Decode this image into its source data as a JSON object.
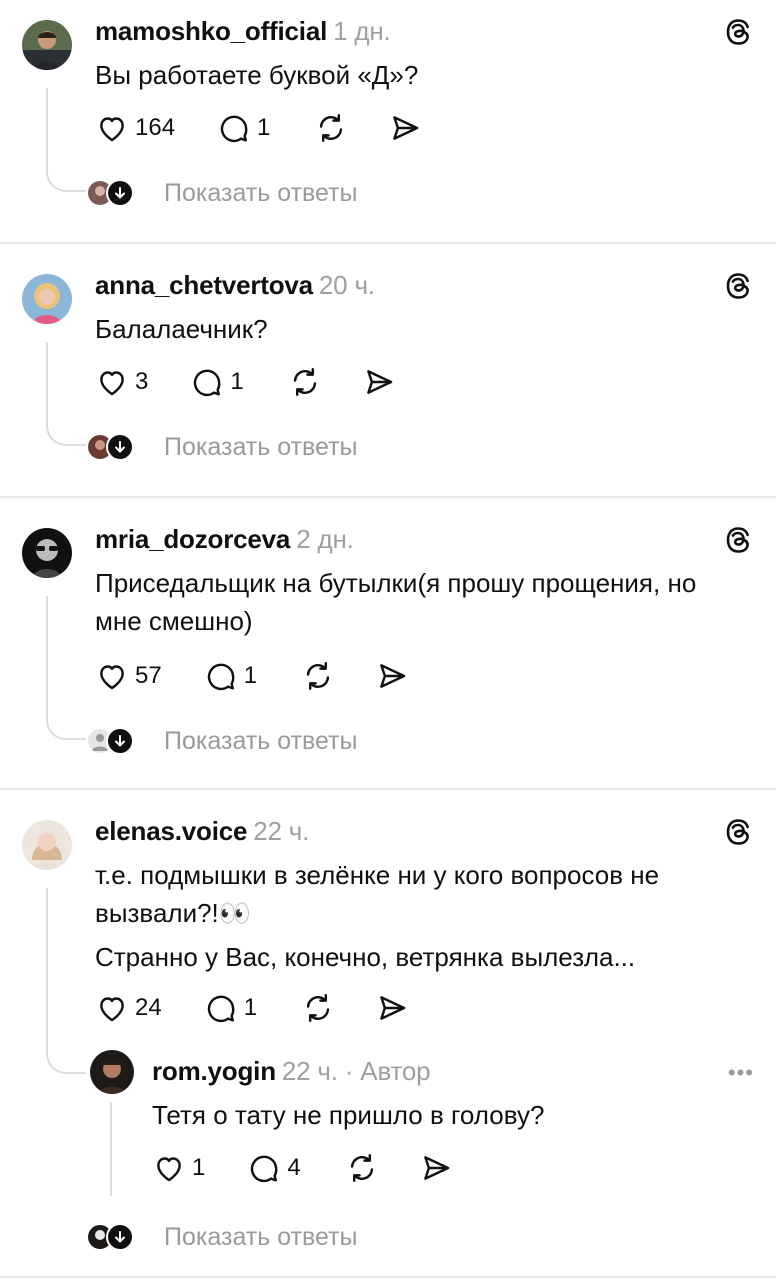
{
  "posts": [
    {
      "username": "mamoshko_official",
      "time": "1 дн.",
      "lines": [
        "Вы работаете буквой «Д»?"
      ],
      "likes": "164",
      "comments": "1",
      "show_replies": "Показать ответы",
      "avatar_color": "#5b6b4e"
    },
    {
      "username": "anna_chetvertova",
      "time": "20 ч.",
      "lines": [
        "Балалаечник?"
      ],
      "likes": "3",
      "comments": "1",
      "show_replies": "Показать ответы",
      "avatar_color": "#d99a9a"
    },
    {
      "username": "mria_dozorceva",
      "time": "2 дн.",
      "lines": [
        "Приседальщик на бутылки(я прошу прощения, но",
        "мне смешно)"
      ],
      "likes": "57",
      "comments": "1",
      "show_replies": "Показать ответы",
      "avatar_color": "#2a2a2a"
    },
    {
      "username": "elenas.voice",
      "time": "22 ч.",
      "lines": [
        "т.е. подмышки в зелёнке ни у кого вопросов не",
        "вызвали?!👀"
      ],
      "line2": "Странно у Вас, конечно, ветрянка вылезла...",
      "likes": "24",
      "comments": "1",
      "avatar_color": "#d8b894"
    }
  ],
  "reply": {
    "username": "rom.yogin",
    "time": "22 ч.",
    "author": "· Автор",
    "text": "Тетя о тату не пришло в голову?",
    "likes": "1",
    "comments": "4",
    "more": "•••",
    "avatar_color": "#3a2a22",
    "show_replies": "Показать ответы"
  },
  "icons": {
    "like": "heart-icon",
    "comment": "comment-bubble-icon",
    "repost": "repost-icon",
    "share": "send-icon",
    "threads": "threads-logo-icon"
  }
}
